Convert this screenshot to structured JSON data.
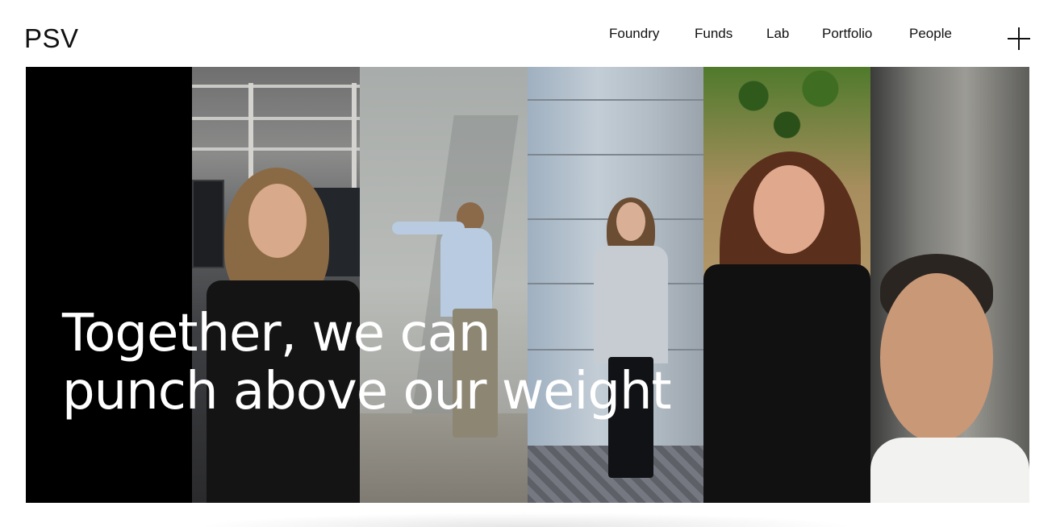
{
  "brand": {
    "logo_text": "PSV"
  },
  "nav": {
    "items": [
      {
        "label": "Foundry"
      },
      {
        "label": "Funds"
      },
      {
        "label": "Lab"
      },
      {
        "label": "Portfolio"
      },
      {
        "label": "People"
      }
    ],
    "menu_icon": "plus-icon"
  },
  "hero": {
    "headline_line1": "Together, we can",
    "headline_line2": "punch above our weight",
    "text_color": "#ffffff",
    "panels": [
      {
        "name": "black-panel"
      },
      {
        "name": "lab-portrait"
      },
      {
        "name": "wall-portrait"
      },
      {
        "name": "metal-wall-portrait"
      },
      {
        "name": "greenery-portrait"
      },
      {
        "name": "closeup-portrait"
      }
    ]
  }
}
